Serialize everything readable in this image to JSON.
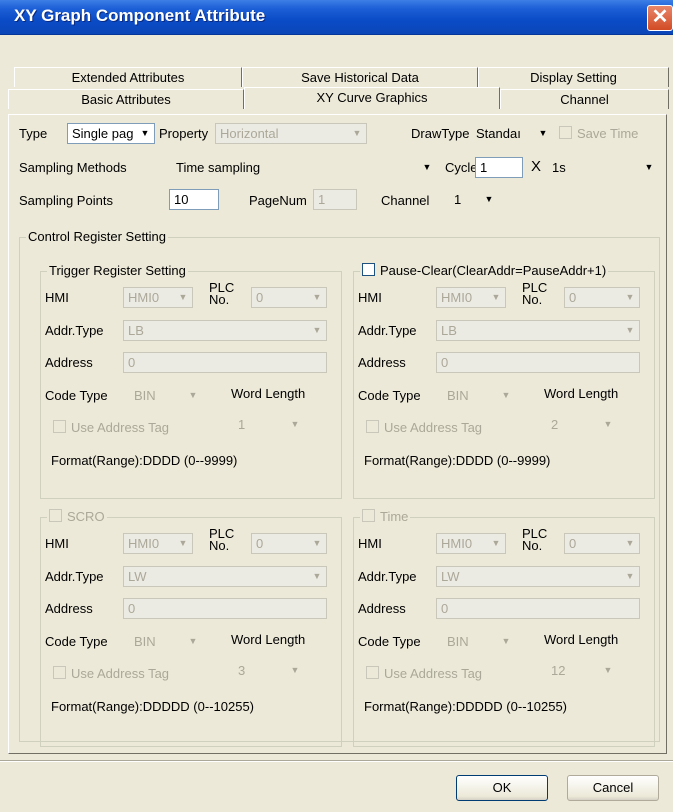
{
  "window": {
    "title": "XY Graph Component Attribute",
    "close_glyph": "✕"
  },
  "tabs_back": [
    "Extended Attributes",
    "Save Historical Data",
    "Display Setting"
  ],
  "tabs_front": [
    "Basic Attributes",
    "XY Curve Graphics",
    "Channel"
  ],
  "row1": {
    "type_label": "Type",
    "type_value": "Single pag",
    "property_label": "Property",
    "property_value": "Horizontal",
    "drawtype_label": "DrawType",
    "drawtype_value": "Standaı",
    "save_time_label": "Save Time"
  },
  "row2": {
    "sampling_label": "Sampling Methods",
    "sampling_value": "Time sampling",
    "cycle_label": "Cycle",
    "cycle_value": "1",
    "times": "X",
    "unit_value": "1s"
  },
  "row3": {
    "points_label": "Sampling Points",
    "points_value": "10",
    "pagenum_label": "PageNum",
    "pagenum_value": "1",
    "channel_label": "Channel",
    "channel_value": "1"
  },
  "control_group": "Control Register Setting",
  "boxes": [
    {
      "title": "Trigger Register Setting",
      "hmi": "HMI0",
      "plc": "0",
      "addr_type": "LB",
      "address": "0",
      "code_type": "BIN",
      "word_len": "1",
      "format": "Format(Range):DDDD (0--9999)"
    },
    {
      "title": "Pause-Clear(ClearAddr=PauseAddr+1)",
      "hmi": "HMI0",
      "plc": "0",
      "addr_type": "LB",
      "address": "0",
      "code_type": "BIN",
      "word_len": "2",
      "format": "Format(Range):DDDD (0--9999)"
    },
    {
      "title": "SCRO",
      "hmi": "HMI0",
      "plc": "0",
      "addr_type": "LW",
      "address": "0",
      "code_type": "BIN",
      "word_len": "3",
      "format": "Format(Range):DDDDD (0--10255)"
    },
    {
      "title": "Time",
      "hmi": "HMI0",
      "plc": "0",
      "addr_type": "LW",
      "address": "0",
      "code_type": "BIN",
      "word_len": "12",
      "format": "Format(Range):DDDDD (0--10255)"
    }
  ],
  "labels": {
    "hmi": "HMI",
    "plc_line1": "PLC",
    "plc_line2": "No.",
    "addr_type": "Addr.Type",
    "address": "Address",
    "code_type": "Code Type",
    "word_length": "Word Length",
    "use_tag": "Use Address Tag"
  },
  "buttons": {
    "ok": "OK",
    "cancel": "Cancel"
  }
}
